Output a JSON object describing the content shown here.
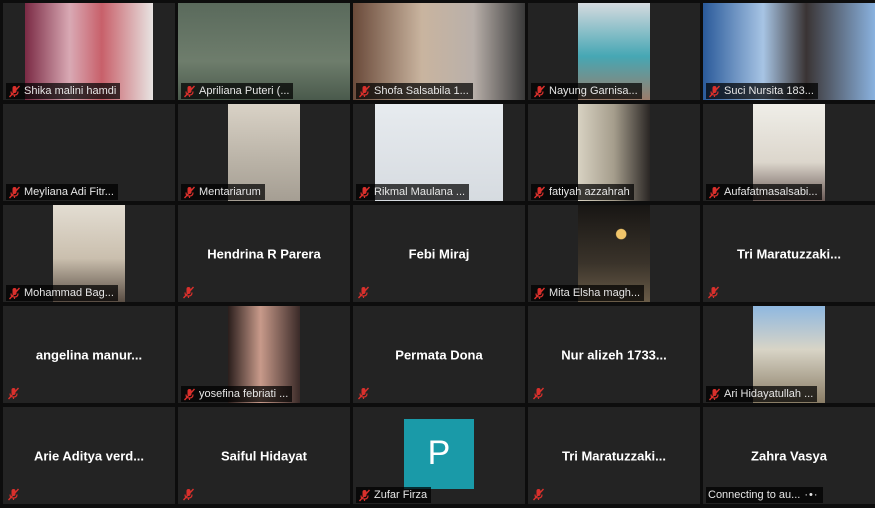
{
  "app": {
    "title": "Video meeting gallery view"
  },
  "colors": {
    "muted_mic": "#d9302c",
    "avatar": "#1a9aa8",
    "tile_bg": "#232323"
  },
  "participants": [
    {
      "name": "Shika malini hamdi",
      "muted": true,
      "video": "on"
    },
    {
      "name": "Apriliana Puteri (...",
      "muted": true,
      "video": "on"
    },
    {
      "name": "Shofa Salsabila 1...",
      "muted": true,
      "video": "on"
    },
    {
      "name": "Nayung Garnisa...",
      "muted": true,
      "video": "on"
    },
    {
      "name": "Suci Nursita 183...",
      "muted": true,
      "video": "on"
    },
    {
      "name": "Meyliana Adi Fitr...",
      "muted": true,
      "video": "off-blank"
    },
    {
      "name": "Mentariarum",
      "muted": true,
      "video": "on"
    },
    {
      "name": "Rikmal Maulana ...",
      "muted": true,
      "video": "on"
    },
    {
      "name": "fatiyah azzahrah",
      "muted": true,
      "video": "on"
    },
    {
      "name": "Aufafatmasalsabi...",
      "muted": true,
      "video": "on"
    },
    {
      "name": "Mohammad Bag...",
      "muted": true,
      "video": "on"
    },
    {
      "name": "Hendrina R Parera",
      "muted": true,
      "video": "off"
    },
    {
      "name": "Febi Miraj",
      "muted": true,
      "video": "off"
    },
    {
      "name": "Mita Elsha magh...",
      "muted": true,
      "video": "on"
    },
    {
      "name": "Tri  Maratuzzaki...",
      "muted": true,
      "video": "off"
    },
    {
      "name": "angelina  manur...",
      "muted": true,
      "video": "off"
    },
    {
      "name": "yosefina febriati ...",
      "muted": true,
      "video": "on"
    },
    {
      "name": "Permata Dona",
      "muted": true,
      "video": "off"
    },
    {
      "name": "Nur alizeh 1733...",
      "muted": true,
      "video": "off"
    },
    {
      "name": "Ari Hidayatullah ...",
      "muted": true,
      "video": "on"
    },
    {
      "name": "Arie Aditya verd...",
      "muted": true,
      "video": "off"
    },
    {
      "name": "Saiful Hidayat",
      "muted": true,
      "video": "off"
    },
    {
      "name": "Zufar Firza",
      "muted": true,
      "video": "avatar",
      "avatar_letter": "P"
    },
    {
      "name": "Tri  Maratuzzaki...",
      "muted": true,
      "video": "off"
    },
    {
      "name": "Zahra Vasya",
      "muted": false,
      "video": "off",
      "status": "Connecting to au...",
      "status_icon": "loading-dots-icon"
    }
  ]
}
